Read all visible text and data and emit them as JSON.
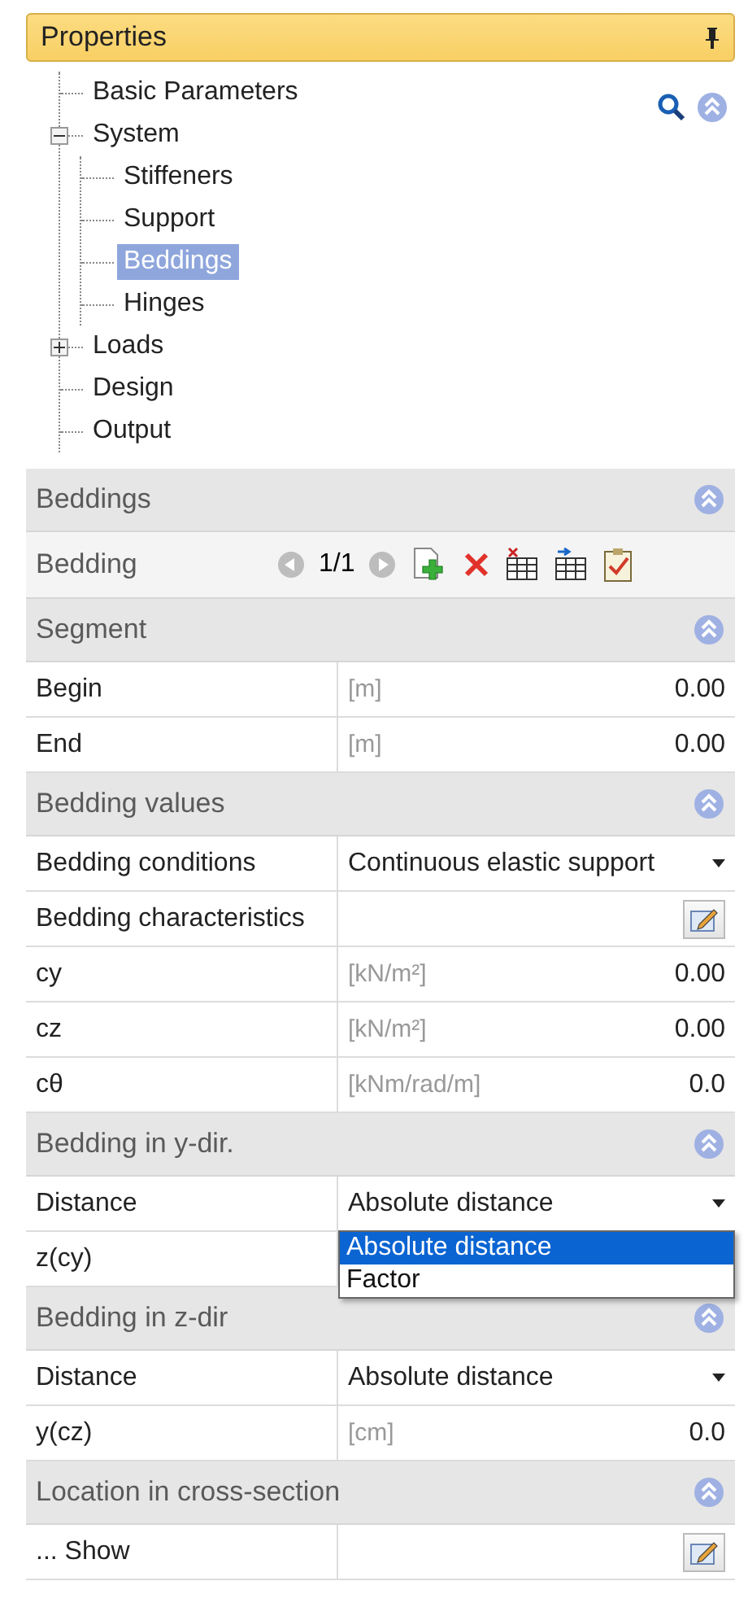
{
  "panel": {
    "title": "Properties"
  },
  "tree": [
    {
      "label": "Basic Parameters",
      "selected": false
    },
    {
      "label": "System",
      "selected": false,
      "expanded": true,
      "children": [
        {
          "label": "Stiffeners",
          "selected": false
        },
        {
          "label": "Support",
          "selected": false
        },
        {
          "label": "Beddings",
          "selected": true
        },
        {
          "label": "Hinges",
          "selected": false
        }
      ]
    },
    {
      "label": "Loads",
      "selected": false,
      "expanded": false
    },
    {
      "label": "Design",
      "selected": false
    },
    {
      "label": "Output",
      "selected": false
    }
  ],
  "sections": [
    {
      "title": "Beddings",
      "rows": [
        {
          "kind": "navigator",
          "label": "Bedding",
          "counter": "1/1"
        }
      ]
    },
    {
      "title": "Segment",
      "rows": [
        {
          "kind": "value",
          "label": "Begin",
          "unit": "[m]",
          "value": "0.00"
        },
        {
          "kind": "value",
          "label": "End",
          "unit": "[m]",
          "value": "0.00"
        }
      ]
    },
    {
      "title": "Bedding values",
      "rows": [
        {
          "kind": "dropdown",
          "label": "Bedding conditions",
          "value": "Continuous elastic support"
        },
        {
          "kind": "button",
          "label": "Bedding characteristics"
        },
        {
          "kind": "value",
          "label": "cy",
          "unit": "[kN/m²]",
          "value": "0.00"
        },
        {
          "kind": "value",
          "label": "cz",
          "unit": "[kN/m²]",
          "value": "0.00"
        },
        {
          "kind": "value",
          "label": "cθ",
          "unit": "[kNm/rad/m]",
          "value": "0.0"
        }
      ]
    },
    {
      "title": "Bedding in y-dir.",
      "rows": [
        {
          "kind": "dropdown",
          "label": "Distance",
          "value": "Absolute distance",
          "options": [
            {
              "label": "Absolute distance",
              "selected": true
            },
            {
              "label": "Factor",
              "selected": false
            }
          ]
        },
        {
          "kind": "covered",
          "label": "z(cy)"
        }
      ]
    },
    {
      "title": "Bedding in z-dir",
      "rows": [
        {
          "kind": "dropdown",
          "label": "Distance",
          "value": "Absolute distance"
        },
        {
          "kind": "value",
          "label": "y(cz)",
          "unit": "[cm]",
          "value": "0.0"
        }
      ]
    },
    {
      "title": "Location in cross-section",
      "rows": [
        {
          "kind": "button",
          "label": "... Show"
        }
      ]
    }
  ]
}
